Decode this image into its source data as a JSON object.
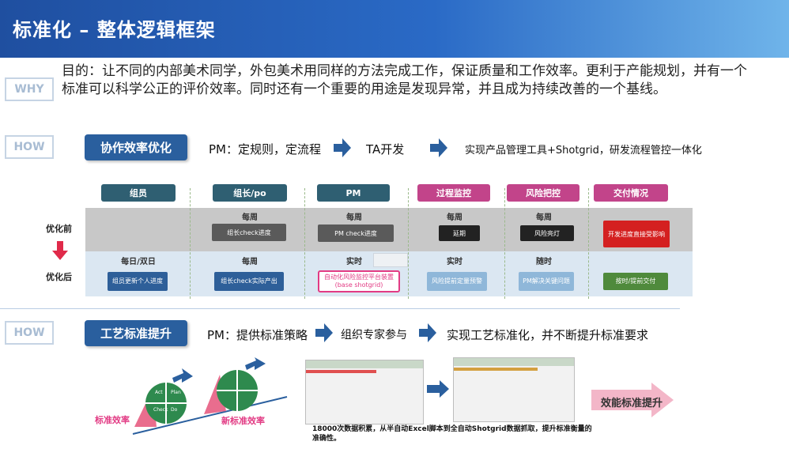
{
  "header": {
    "title": "标准化 – 整体逻辑框架"
  },
  "why": {
    "tag": "WHY",
    "text": "目的：让不同的内部美术同学，外包美术用同样的方法完成工作，保证质量和工作效率。更利于产能规划，并有一个标准可以科学公正的评价效率。同时还有一个重要的用途是发现异常，并且成为持续改善的一个基线。"
  },
  "how1": {
    "tag": "HOW",
    "button": "协作效率优化",
    "steps": [
      "PM：定规则，定流程",
      "TA开发",
      "实现产品管理工具+Shotgrid，研发流程管控一体化"
    ]
  },
  "table": {
    "headers": [
      {
        "label": "组员",
        "color": "#2f5f72"
      },
      {
        "label": "组长/po",
        "color": "#2f5f72"
      },
      {
        "label": "PM",
        "color": "#2f5f72"
      },
      {
        "label": "过程监控",
        "color": "#c2448a"
      },
      {
        "label": "风险把控",
        "color": "#c2448a"
      },
      {
        "label": "交付情况",
        "color": "#c2448a"
      }
    ],
    "before_label": "优化前",
    "after_label": "优化后",
    "before_freq": [
      "每周",
      "每周",
      "每周",
      "每周"
    ],
    "before_boxes": [
      "组长check进度",
      "PM check进度",
      "延期",
      "风险亮灯",
      "开发进度直接受影响"
    ],
    "after_freq": [
      "每日/双日",
      "每周",
      "实时",
      "实时",
      "随时"
    ],
    "after_boxes": [
      "组员更新个人进度",
      "组长check实际产出",
      "自动化风险监控平台装置(base shotgrid)",
      "风险提前定量预警",
      "PM解决关键问题",
      "按时/提前交付"
    ]
  },
  "how2": {
    "tag": "HOW",
    "button": "工艺标准提升",
    "steps": [
      "PM：提供标准策略",
      "组织专家参与",
      "实现工艺标准化，并不断提升标准要求"
    ]
  },
  "bottom": {
    "left_label": "标准效率",
    "right_label": "新标准效率",
    "pdca": [
      "Act",
      "Plan",
      "Check",
      "Do"
    ],
    "result": "效能标准提升",
    "note": "18000次数据积累，从半自动Excel脚本到全自动Shotgrid数据抓取，提升标准衡量的准确性。"
  }
}
